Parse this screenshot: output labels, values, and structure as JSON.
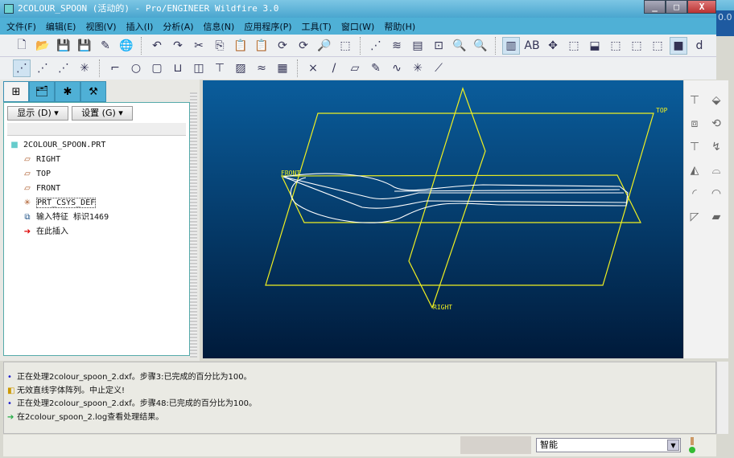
{
  "window": {
    "title": "2COLOUR_SPOON (活动的) - Pro/ENGINEER Wildfire 3.0",
    "overlay_text": "0.0"
  },
  "menu": [
    "文件(F)",
    "编辑(E)",
    "视图(V)",
    "插入(I)",
    "分析(A)",
    "信息(N)",
    "应用程序(P)",
    "工具(T)",
    "窗口(W)",
    "帮助(H)"
  ],
  "toolbar1": [
    "new-file-icon",
    "open-icon",
    "save-icon",
    "save-copy-icon",
    "edit-icon",
    "globe-icon",
    "|",
    "undo-icon",
    "redo-icon",
    "cut-icon",
    "copy-icon",
    "paste-icon",
    "paste-special-icon",
    "regenerate-icon",
    "regen-manager-icon",
    "find-icon",
    "select-box-icon",
    "|",
    "datum-display-icon",
    "layers-icon",
    "view-manager-icon",
    "refit-icon",
    "zoom-in-icon",
    "zoom-out-icon",
    "|",
    "color-appearance-icon",
    "name-icon",
    "spin-center-icon",
    "select-window-icon",
    "orient-icon",
    "wireframe-icon",
    "hidden-line-icon",
    "no-hidden-icon",
    "shading-icon",
    "dimension-icon"
  ],
  "toolbar2": [
    "datum-plane-display-icon",
    "datum-axis-display-icon",
    "datum-point-display-icon",
    "csys-display-icon",
    "|",
    "edge-icon",
    "circle-icon",
    "box-icon",
    "shell-icon",
    "rib-icon",
    "draft-icon",
    "pattern-icon",
    "surface-icon",
    "grid-icon",
    "|",
    "point-icon",
    "axis-icon",
    "plane-icon",
    "sketch-icon",
    "curve-icon",
    "csys-icon",
    "analysis-icon"
  ],
  "left_panel": {
    "tabs": [
      "model-tree-tab",
      "folder-tab",
      "favorites-tab",
      "tools-tab"
    ],
    "show_label": "显示 (D) ▾",
    "settings_label": "设置 (G) ▾",
    "tree": [
      {
        "label": "2COLOUR_SPOON.PRT",
        "icon": "part-icon"
      },
      {
        "label": "RIGHT",
        "icon": "datum-plane-icon"
      },
      {
        "label": "TOP",
        "icon": "datum-plane-icon"
      },
      {
        "label": "FRONT",
        "icon": "datum-plane-icon"
      },
      {
        "label": "PRT_CSYS_DEF",
        "icon": "csys-icon"
      },
      {
        "label": "输入特征 标识1469",
        "icon": "import-feature-icon"
      },
      {
        "label": "在此插入",
        "icon": "insert-here-arrow-icon"
      }
    ]
  },
  "viewport": {
    "labels": {
      "top": "TOP",
      "front": "FRONT",
      "right": "RIGHT"
    },
    "background": "#0a5d9c",
    "plane_color": "#f0f020",
    "geometry_color": "#ffffff"
  },
  "right_toolbar": [
    "draft-feature-icon",
    "extrude-icon",
    "offset-icon",
    "revolve-icon",
    "draft-check-icon",
    "sweep-icon",
    "blend-icon",
    "boundary-surface-icon",
    "round-icon",
    "fill-icon",
    "chamfer-icon",
    "solidify-icon"
  ],
  "messages": [
    {
      "icon": "info-dot-icon",
      "text": "正在处理2colour_spoon_2.dxf。步骤3:已完成的百分比为100。"
    },
    {
      "icon": "warning-icon",
      "text": "无效直线字体阵列。中止定义!"
    },
    {
      "icon": "info-dot-icon",
      "text": "正在处理2colour_spoon_2.dxf。步骤48:已完成的百分比为100。"
    },
    {
      "icon": "prompt-arrow-icon",
      "text": "在2colour_spoon_2.log查看处理结果。"
    }
  ],
  "status": {
    "filter_value": "智能"
  }
}
